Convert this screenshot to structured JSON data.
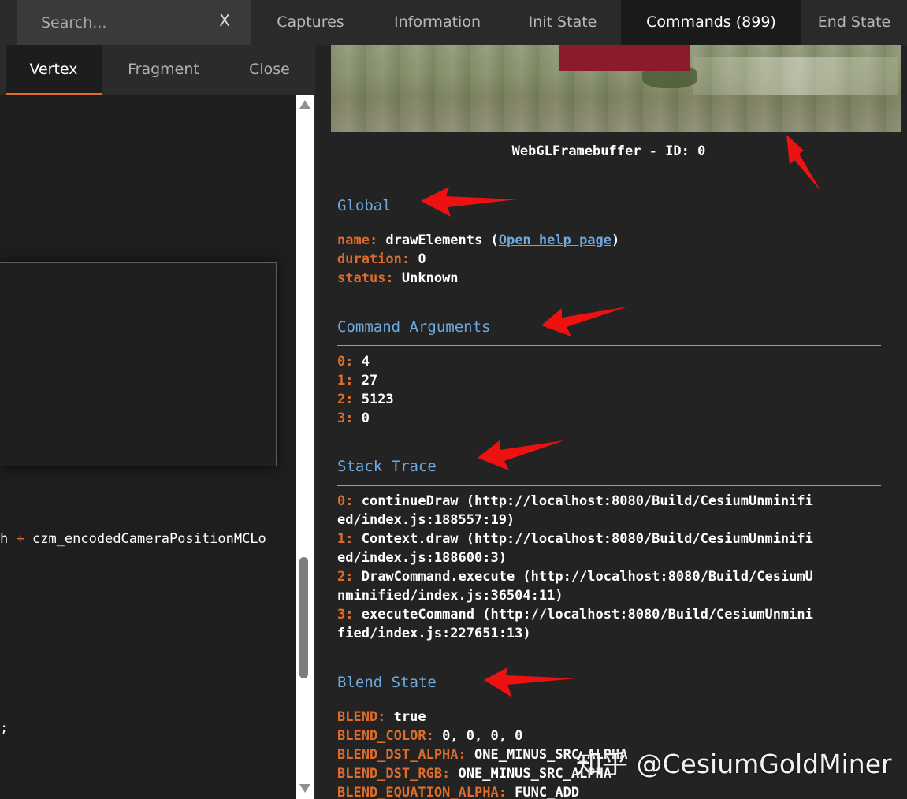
{
  "search": {
    "placeholder": "Search...",
    "clear_label": "X"
  },
  "top_tabs": [
    {
      "label": "Captures"
    },
    {
      "label": "Information"
    },
    {
      "label": "Init State"
    },
    {
      "label": "Commands (899)",
      "active": true
    },
    {
      "label": "End State"
    }
  ],
  "shader_tabs": [
    {
      "label": "Vertex",
      "active": true
    },
    {
      "label": "Fragment"
    },
    {
      "label": "Close"
    }
  ],
  "code_lines": [
    {
      "before": "h ",
      "op": "+",
      "after": " czm_encodedCameraPositionMCLo"
    },
    {
      "before": ";",
      "op": "",
      "after": ""
    }
  ],
  "framebuffer": {
    "caption": "WebGLFramebuffer - ID: 0"
  },
  "global": {
    "title": "Global",
    "name_key": "name: ",
    "name_value": "drawElements (",
    "help_link": "Open help page",
    "name_close": ")",
    "duration_key": "duration: ",
    "duration_value": "0",
    "status_key": "status: ",
    "status_value": "Unknown"
  },
  "command_arguments": {
    "title": "Command Arguments",
    "items": [
      {
        "key": "0: ",
        "value": "4"
      },
      {
        "key": "1: ",
        "value": "27"
      },
      {
        "key": "2: ",
        "value": "5123"
      },
      {
        "key": "3: ",
        "value": "0"
      }
    ]
  },
  "stack_trace": {
    "title": "Stack Trace",
    "lines": [
      {
        "key": "0: ",
        "text": "continueDraw (http://localhost:8080/Build/CesiumUnminifi"
      },
      {
        "key": "",
        "text": "ed/index.js:188557:19)"
      },
      {
        "key": "1: ",
        "text": "Context.draw (http://localhost:8080/Build/CesiumUnminifi"
      },
      {
        "key": "",
        "text": "ed/index.js:188600:3)"
      },
      {
        "key": "2: ",
        "text": "DrawCommand.execute (http://localhost:8080/Build/CesiumU"
      },
      {
        "key": "",
        "text": "nminified/index.js:36504:11)"
      },
      {
        "key": "3: ",
        "text": "executeCommand (http://localhost:8080/Build/CesiumUnmini"
      },
      {
        "key": "",
        "text": "fied/index.js:227651:13)"
      }
    ]
  },
  "blend_state": {
    "title": "Blend State",
    "items": [
      {
        "key": "BLEND: ",
        "value": "true"
      },
      {
        "key": "BLEND_COLOR: ",
        "value": "0, 0, 0, 0"
      },
      {
        "key": "BLEND_DST_ALPHA: ",
        "value": "ONE_MINUS_SRC_ALPHA"
      },
      {
        "key": "BLEND_DST_RGB: ",
        "value": "ONE_MINUS_SRC_ALPHA"
      },
      {
        "key": "BLEND_EQUATION_ALPHA: ",
        "value": "FUNC_ADD"
      }
    ]
  },
  "watermark": "知乎 @CesiumGoldMiner",
  "colors": {
    "key_orange": "#e06c2b",
    "title_blue": "#6fa8dc",
    "arrow_red": "#ee1111",
    "active_tab_underline": "#e06c2b"
  }
}
